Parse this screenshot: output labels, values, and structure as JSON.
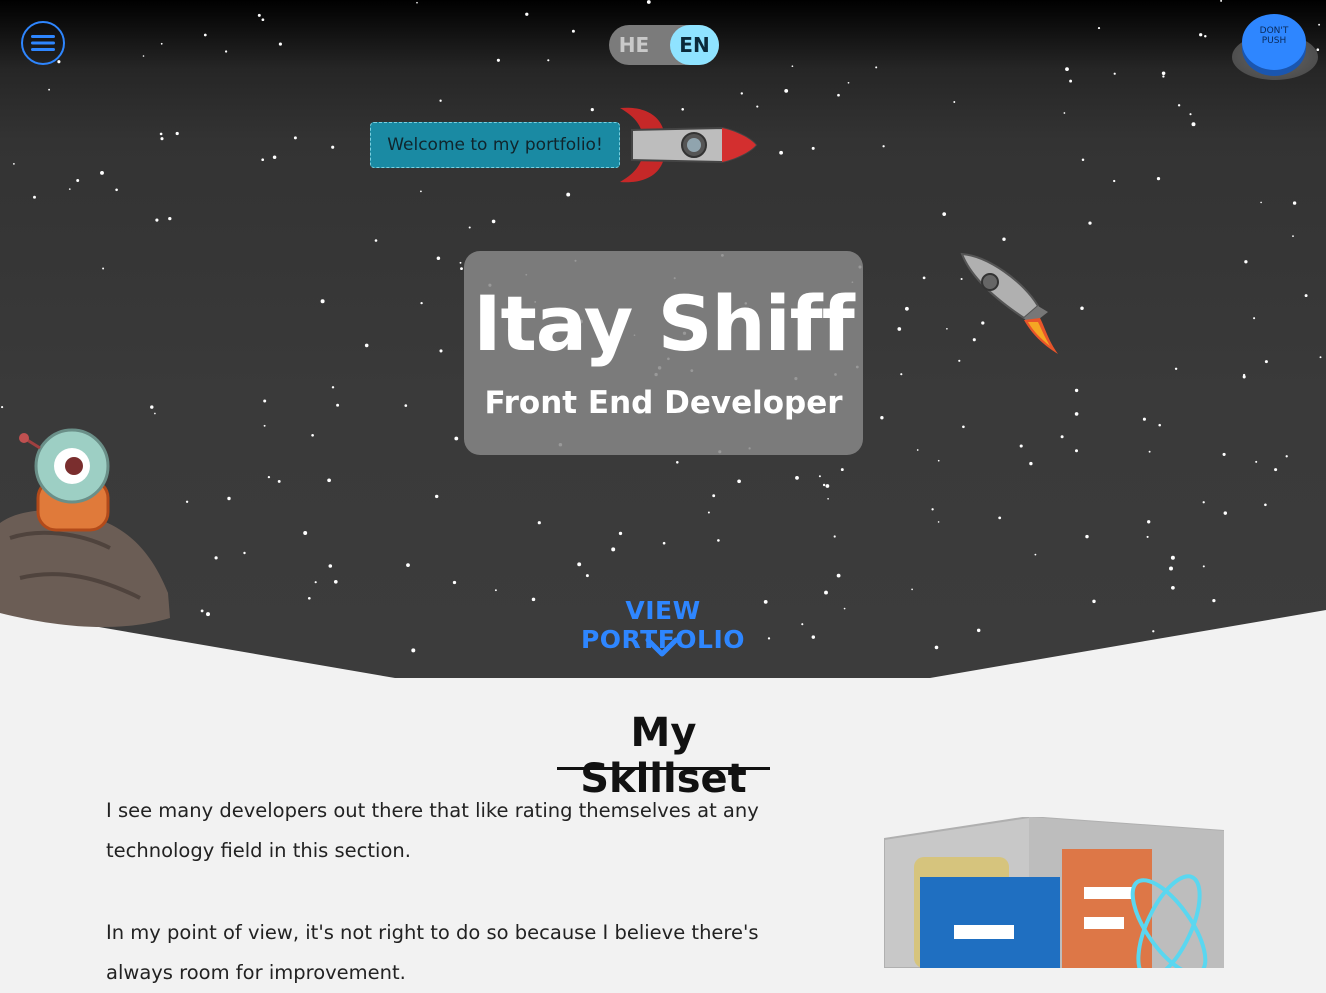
{
  "nav": {
    "menu_icon": "hamburger-menu-icon"
  },
  "language": {
    "he": "HE",
    "en": "EN",
    "selected": "EN"
  },
  "push_button": {
    "line1": "DON'T",
    "line2": "PUSH"
  },
  "welcome": {
    "text": "Welcome to my portfolio!"
  },
  "hero": {
    "name": "Itay Shiff",
    "role": "Front End Developer",
    "cta": "VIEW PORTFOLIO",
    "cta_icon": "chevron-down-icon"
  },
  "skills": {
    "title": "My Skillset",
    "paragraph1": "I see many developers out there that like rating themselves at any technology field in this section.",
    "paragraph2": "In my point of view, it's not right to do so because I believe there's always room for improvement."
  },
  "colors": {
    "accent": "#2e86ff",
    "lang_active": "#8fe3ff",
    "welcome_bg": "#1a8aa3"
  }
}
